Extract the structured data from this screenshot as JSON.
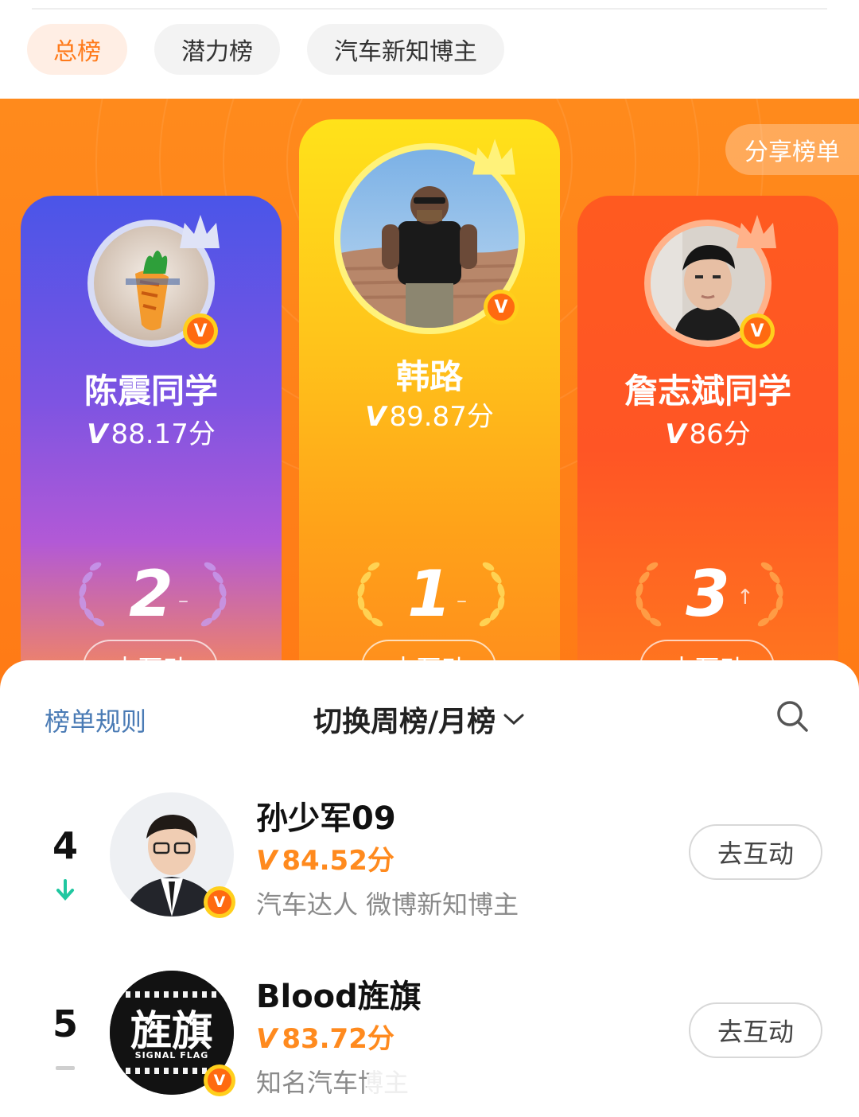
{
  "tabs": [
    "总榜",
    "潜力榜",
    "汽车新知博主"
  ],
  "hero": {
    "share_label": "分享榜单",
    "cards": [
      {
        "rank": "2",
        "name": "陈震同学",
        "score": "88.17分",
        "trend": "–",
        "action": "去互动"
      },
      {
        "rank": "1",
        "name": "韩路",
        "score": "89.87分",
        "trend": "–",
        "action": "去互动"
      },
      {
        "rank": "3",
        "name": "詹志斌同学",
        "score": "86分",
        "trend": "↑",
        "action": "去互动"
      }
    ]
  },
  "controls": {
    "rules_label": "榜单规则",
    "switch_label": "切换周榜/月榜"
  },
  "list": [
    {
      "rank": "4",
      "trend": "down",
      "name": "孙少军09",
      "score": "84.52分",
      "desc": "汽车达人 微博新知博主",
      "action": "去互动"
    },
    {
      "rank": "5",
      "trend": "same",
      "name": "Blood旌旗",
      "score": "83.72分",
      "desc": "知名汽车博主",
      "action": "去互动",
      "avatar_text": "旌旗",
      "avatar_sub": "SIGNAL FLAG"
    }
  ],
  "colors": {
    "accent": "#ff7a1a",
    "link": "#4a7bb5",
    "trend_down": "#1fc7a0"
  },
  "badge_letter": "V"
}
